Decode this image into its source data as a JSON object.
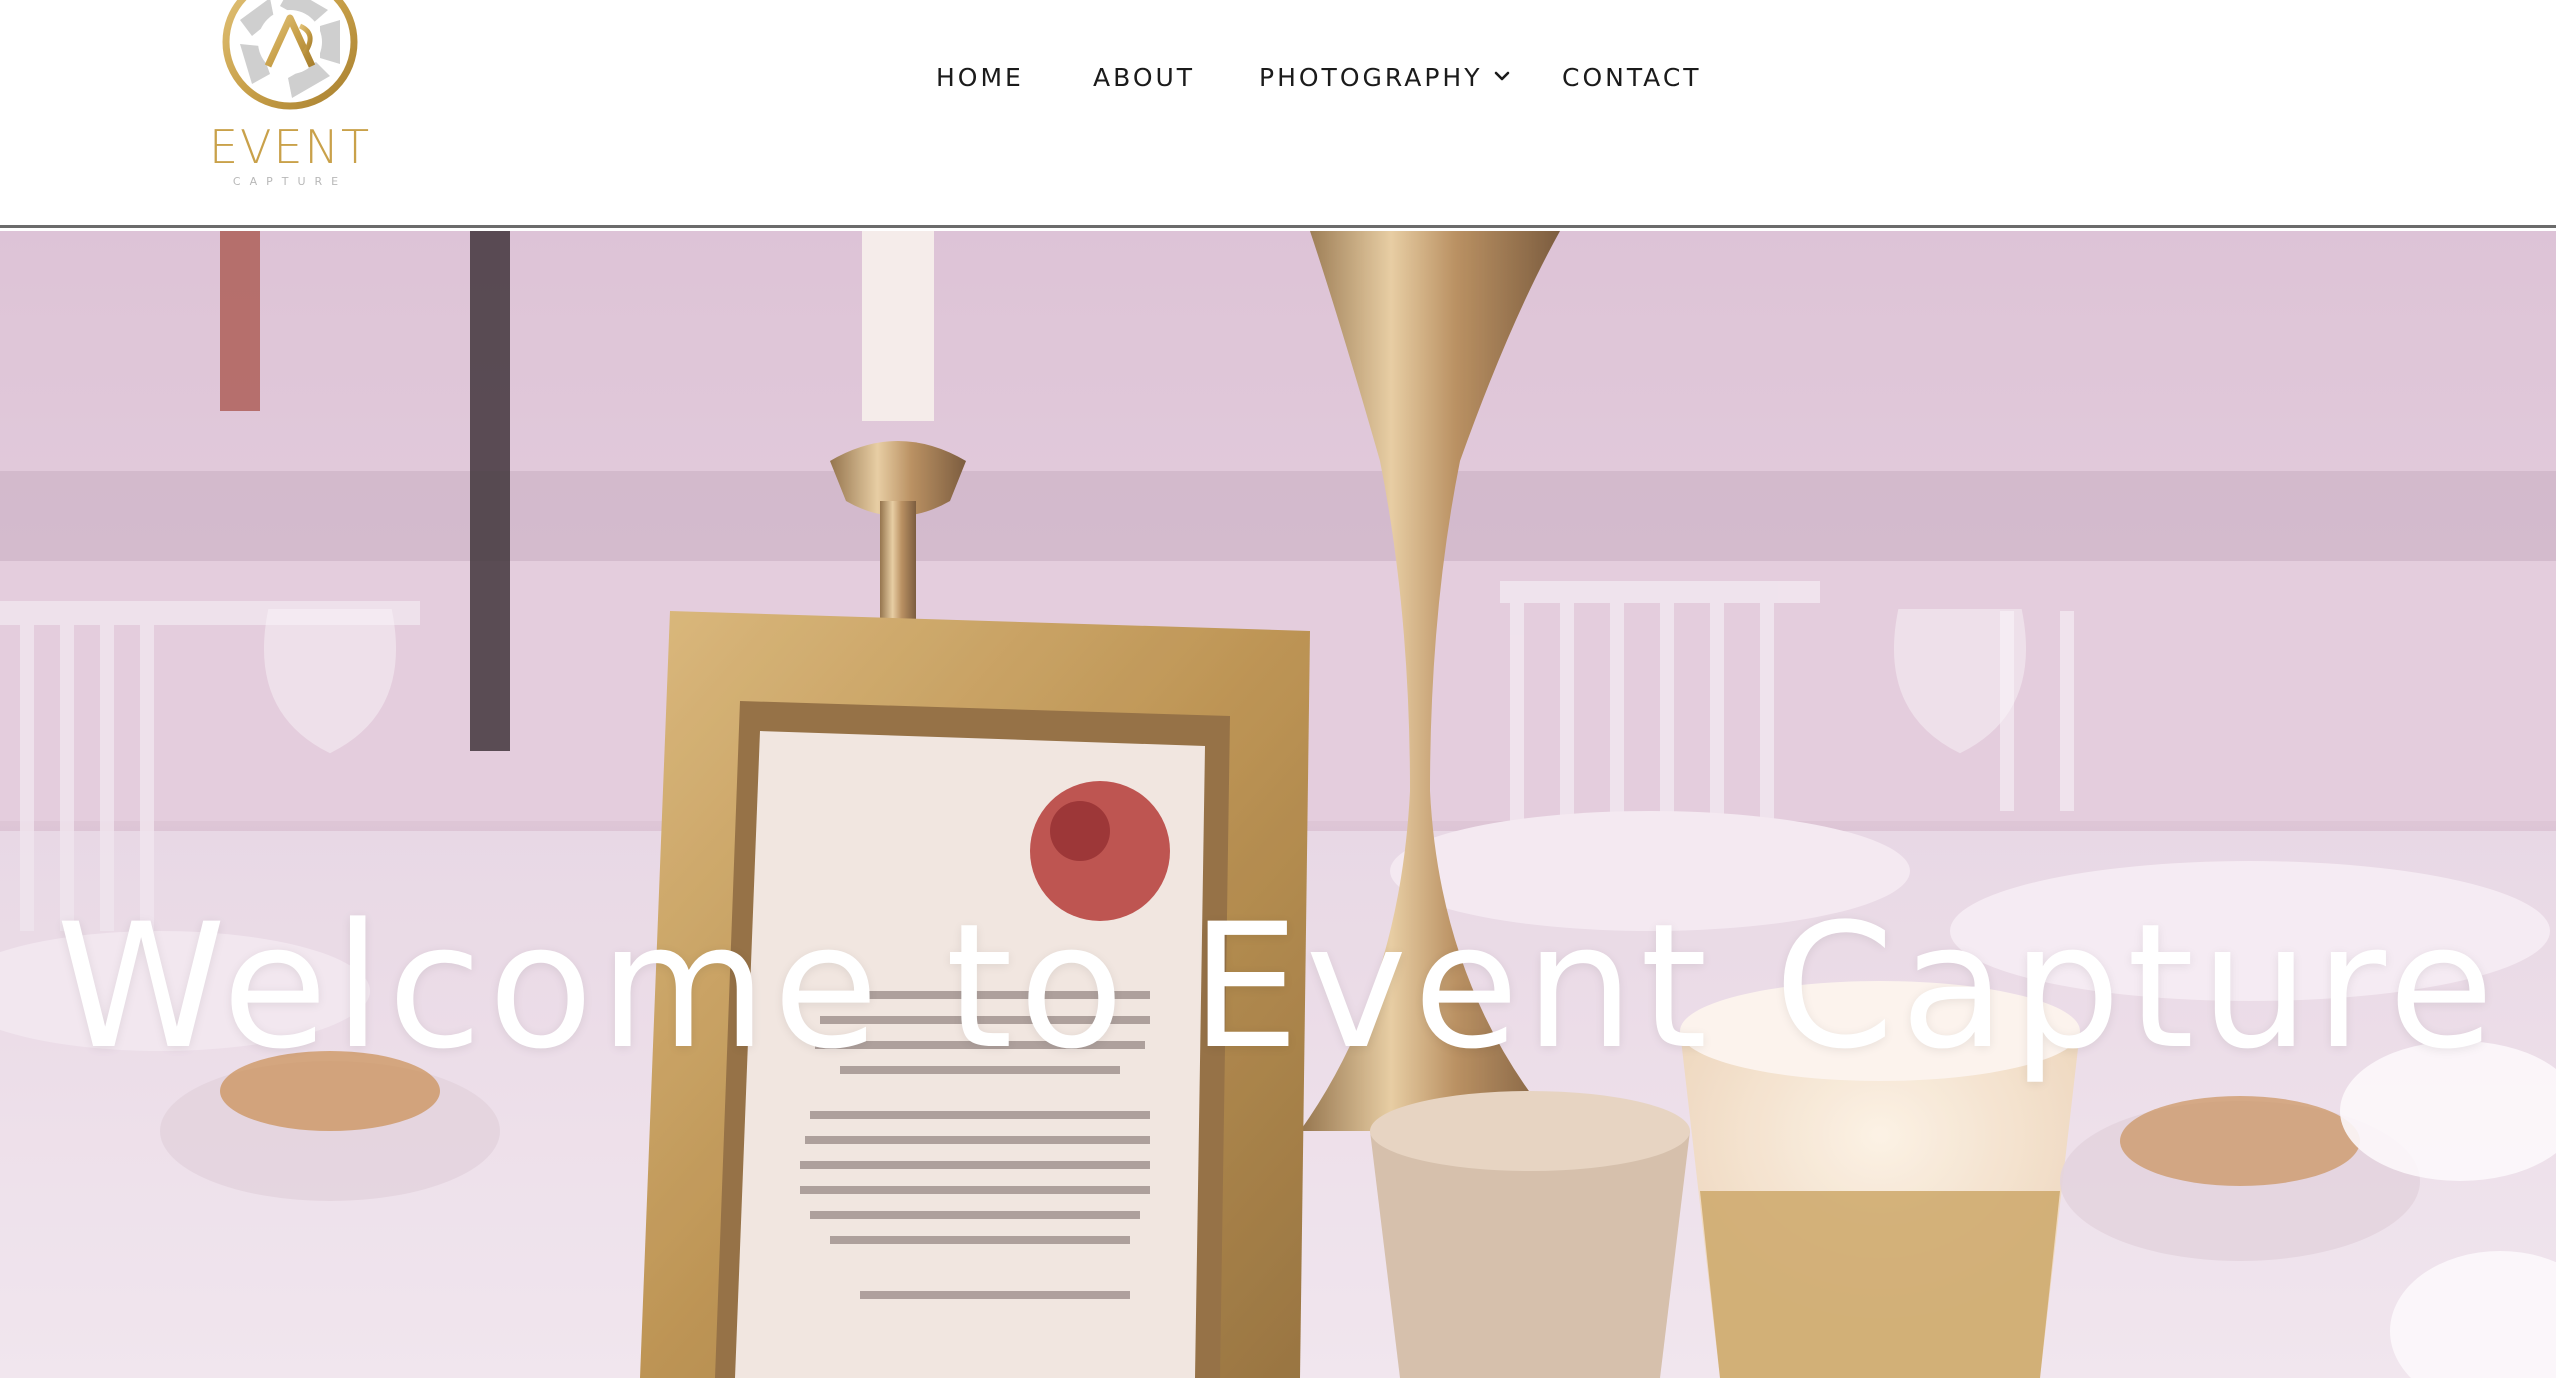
{
  "brand": {
    "logo_icon": "camera-aperture-ec-monogram",
    "wordmark": "EVENT",
    "subtitle": "CAPTURE",
    "gold_color": "#c9a14a",
    "silver_color": "#c8c8c8"
  },
  "nav": {
    "home": "HOME",
    "about": "ABOUT",
    "photography": "PHOTOGRAPHY",
    "photography_icon": "chevron-down-icon",
    "contact": "CONTACT"
  },
  "hero": {
    "title": "Welcome to Event Capture",
    "background": "wedding table setting with gilded picture frame, candles and gold vase"
  }
}
